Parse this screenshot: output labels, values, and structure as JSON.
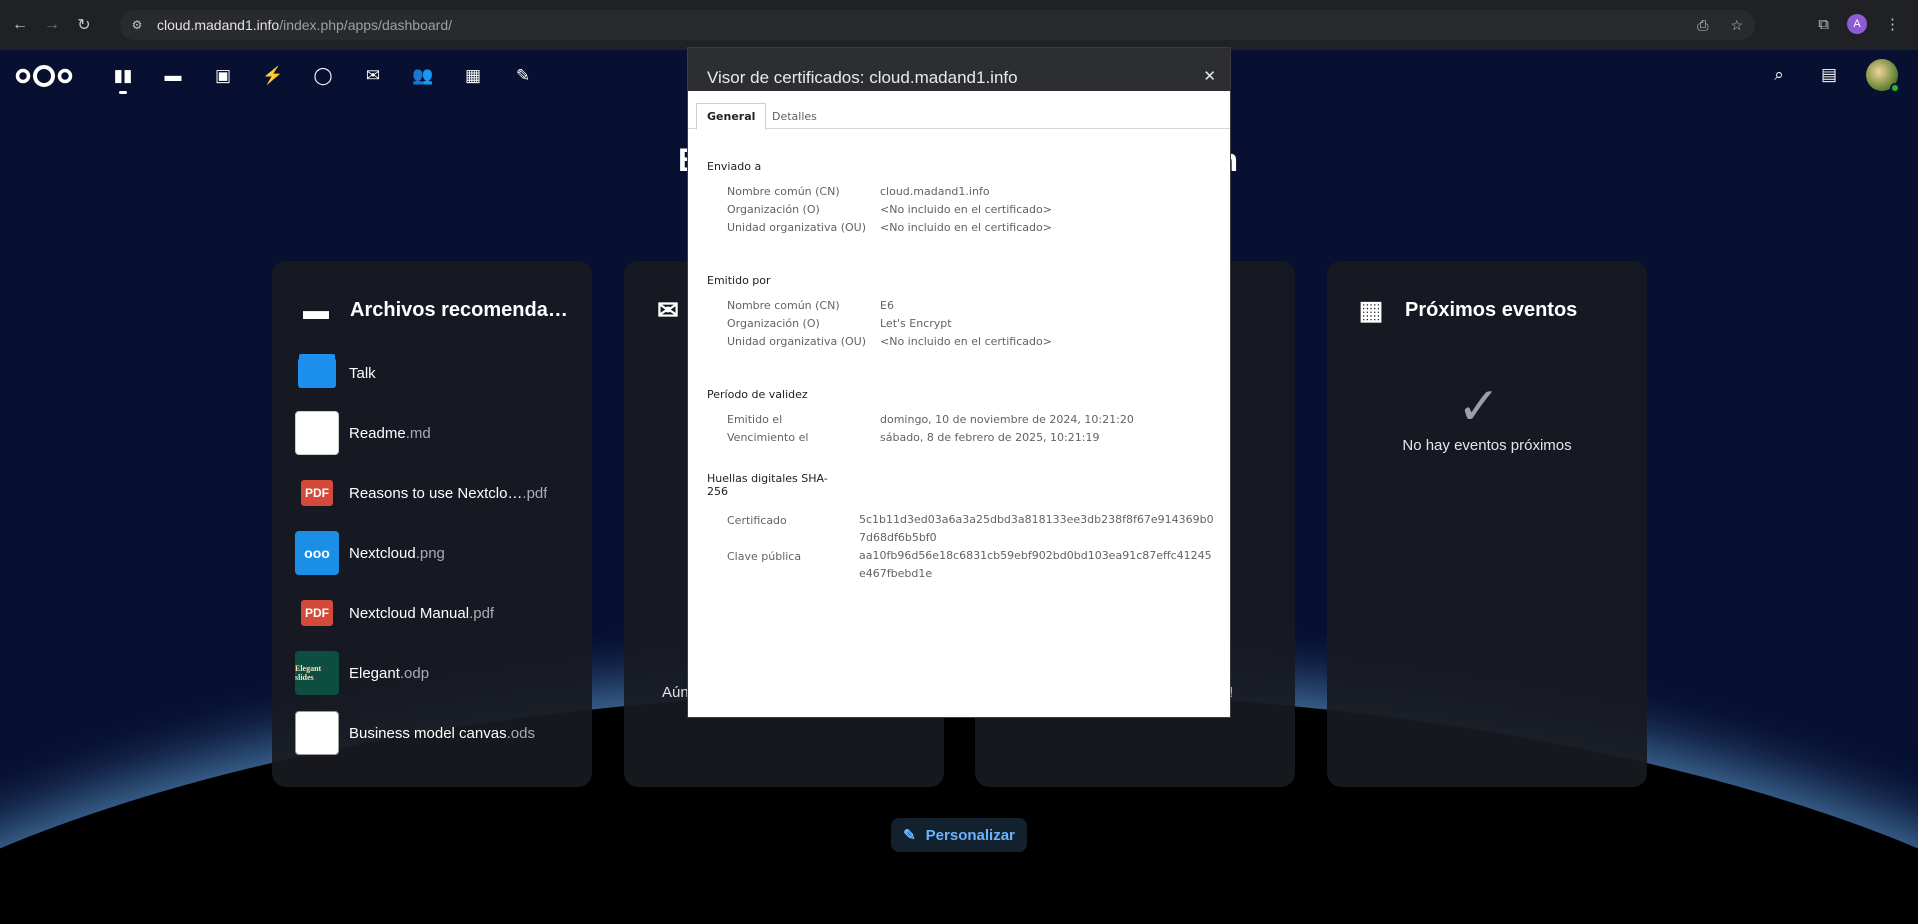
{
  "browser": {
    "url_host": "cloud.madand1.info",
    "url_path": "/index.php/apps/dashboard/",
    "profile_initial": "A"
  },
  "header": {
    "apps": [
      "dashboard-icon",
      "files-icon",
      "photos-icon",
      "activity-icon",
      "talk-icon",
      "mail-icon",
      "contacts-icon",
      "calendar-icon",
      "notes-icon"
    ]
  },
  "greeting": {
    "left": "B",
    "right": "n"
  },
  "widgets": {
    "files": {
      "title": "Archivos recomenda…",
      "items": [
        {
          "name": "Talk",
          "ext": "",
          "type": "folder"
        },
        {
          "name": "Readme",
          "ext": ".md",
          "type": "md"
        },
        {
          "name": "Reasons to use Nextclo…",
          "ext": ".pdf",
          "type": "pdf",
          "thumb": "PDF"
        },
        {
          "name": "Nextcloud",
          "ext": ".png",
          "type": "png",
          "thumb": "ooo"
        },
        {
          "name": "Nextcloud Manual",
          "ext": ".pdf",
          "type": "pdf",
          "thumb": "PDF"
        },
        {
          "name": "Elegant",
          "ext": ".odp",
          "type": "odp",
          "thumb": "Elegant slides"
        },
        {
          "name": "Business model canvas",
          "ext": ".ods",
          "type": "ods"
        }
      ]
    },
    "mail": {
      "partial_text": "Aún"
    },
    "third": {
      "partial_text": "!"
    },
    "events": {
      "title": "Próximos eventos",
      "empty": "No hay eventos próximos"
    }
  },
  "customize_label": "Personalizar",
  "cert": {
    "title": "Visor de certificados: cloud.madand1.info",
    "tabs": {
      "general": "General",
      "details": "Detalles"
    },
    "issued_to": {
      "title": "Enviado a",
      "rows": [
        {
          "label": "Nombre común (CN)",
          "value": "cloud.madand1.info"
        },
        {
          "label": "Organización (O)",
          "value": "<No incluido en el certificado>"
        },
        {
          "label": "Unidad organizativa (OU)",
          "value": "<No incluido en el certificado>"
        }
      ]
    },
    "issued_by": {
      "title": "Emitido por",
      "rows": [
        {
          "label": "Nombre común (CN)",
          "value": "E6"
        },
        {
          "label": "Organización (O)",
          "value": "Let's Encrypt"
        },
        {
          "label": "Unidad organizativa (OU)",
          "value": "<No incluido en el certificado>"
        }
      ]
    },
    "validity": {
      "title": "Período de validez",
      "rows": [
        {
          "label": "Emitido el",
          "value": "domingo, 10 de noviembre de 2024, 10:21:20"
        },
        {
          "label": "Vencimiento el",
          "value": "sábado, 8 de febrero de 2025, 10:21:19"
        }
      ]
    },
    "fingerprints": {
      "title_line1": "Huellas digitales SHA-",
      "title_line2": "256",
      "rows": [
        {
          "label": "Certificado",
          "value": "5c1b11d3ed03a6a3a25dbd3a818133ee3db238f8f67e914369b07d68df6b5bf0"
        },
        {
          "label": "Clave pública",
          "value": "aa10fb96d56e18c6831cb59ebf902bd0bd103ea91c87effc41245e467fbebd1e"
        }
      ]
    }
  },
  "colors": {
    "accent": "#6ab4ff",
    "folder": "#1d8fed",
    "pdf": "#d34a3a",
    "status_online": "#2fb130"
  }
}
